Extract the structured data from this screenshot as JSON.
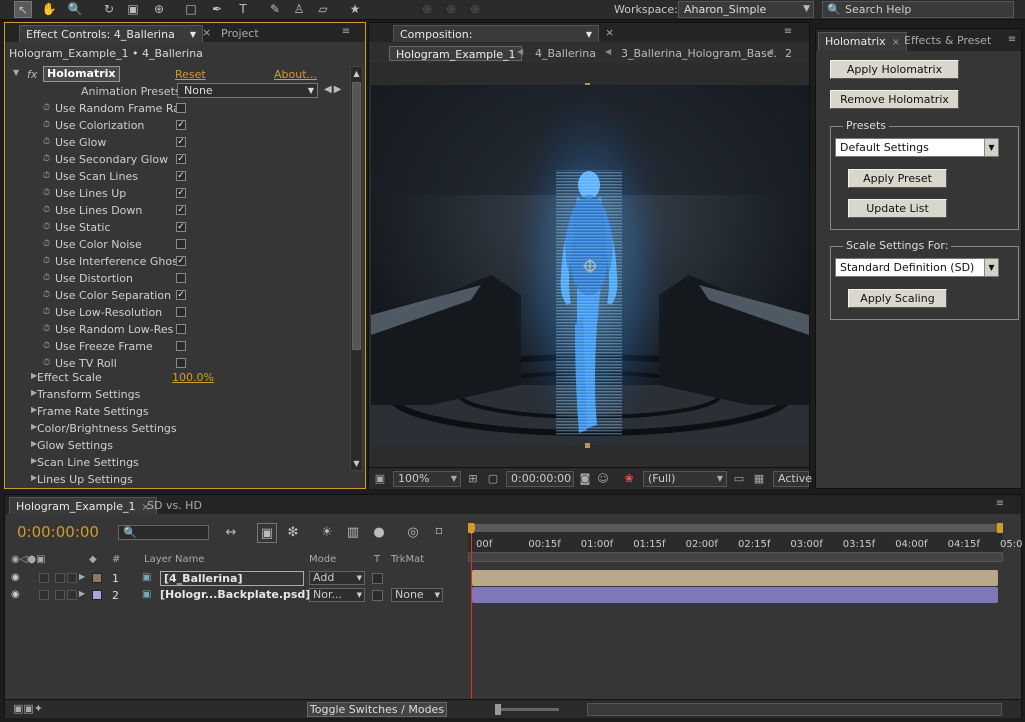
{
  "workspace": {
    "label": "Workspace:",
    "value": "Aharon_Simple"
  },
  "search_help": "Search Help",
  "effect_controls": {
    "tab_label": "Effect Controls: 4_Ballerina",
    "tab2_label": "Project",
    "subtitle": "Hologram_Example_1 • 4_Ballerina",
    "effect_name": "Holomatrix",
    "reset": "Reset",
    "about": "About...",
    "animation_presets_label": "Animation Presets:",
    "animation_presets_value": "None",
    "checkboxes": [
      {
        "label": "Use Random Frame Ra",
        "checked": false
      },
      {
        "label": "Use Colorization",
        "checked": true
      },
      {
        "label": "Use Glow",
        "checked": true
      },
      {
        "label": "Use Secondary Glow",
        "checked": true
      },
      {
        "label": "Use Scan Lines",
        "checked": true
      },
      {
        "label": "Use Lines Up",
        "checked": true
      },
      {
        "label": "Use Lines Down",
        "checked": true
      },
      {
        "label": "Use Static",
        "checked": true
      },
      {
        "label": "Use Color Noise",
        "checked": false
      },
      {
        "label": "Use Interference Ghos",
        "checked": true
      },
      {
        "label": "Use Distortion",
        "checked": false
      },
      {
        "label": "Use Color Separation",
        "checked": true
      },
      {
        "label": "Use Low-Resolution",
        "checked": false
      },
      {
        "label": "Use Random Low-Res",
        "checked": false
      },
      {
        "label": "Use Freeze Frame",
        "checked": false
      },
      {
        "label": "Use TV Roll",
        "checked": false
      }
    ],
    "effect_scale_label": "Effect Scale",
    "effect_scale_value": "100.0%",
    "groups": [
      "Transform Settings",
      "Frame Rate Settings",
      "Color/Brightness Settings",
      "Glow Settings",
      "Scan Line Settings",
      "Lines Up Settings"
    ]
  },
  "composition": {
    "tab_label": "Composition: Hologram_Example_1",
    "crumbs": [
      "Hologram_Example_1",
      "4_Ballerina",
      "3_Ballerina_Hologram_Base.",
      "2"
    ],
    "zoom": "100%",
    "timecode": "0:00:00:00",
    "resolution": "(Full)",
    "active_camera": "Active"
  },
  "holomatrix": {
    "tab_label": "Holomatrix",
    "tab2_label": "Effects & Preset",
    "apply_btn": "Apply Holomatrix",
    "remove_btn": "Remove Holomatrix",
    "presets_title": "Presets",
    "presets_value": "Default Settings",
    "apply_preset": "Apply Preset",
    "update_list": "Update List",
    "scale_title": "Scale Settings For:",
    "scale_value": "Standard Definition (SD)",
    "apply_scaling": "Apply Scaling"
  },
  "timeline": {
    "tab_label": "Hologram_Example_1",
    "tab2_label": "SD vs. HD",
    "timecode": "0:00:00:00",
    "col_hash": "#",
    "col_layer_name": "Layer Name",
    "col_mode": "Mode",
    "col_t": "T",
    "col_trkmat": "TrkMat",
    "ruler_ticks": [
      "00f",
      "00:15f",
      "01:00f",
      "01:15f",
      "02:00f",
      "02:15f",
      "03:00f",
      "03:15f",
      "04:00f",
      "04:15f",
      "05:0"
    ],
    "layers": [
      {
        "num": "1",
        "name": "[4_Ballerina]",
        "mode": "Add",
        "trkmat": "",
        "color": "#8c7a5a"
      },
      {
        "num": "2",
        "name": "[Hologr...Backplate.psd]",
        "mode": "Nor...",
        "trkmat": "None",
        "color": "#a9a3d6"
      }
    ],
    "toggle_label": "Toggle Switches / Modes"
  }
}
